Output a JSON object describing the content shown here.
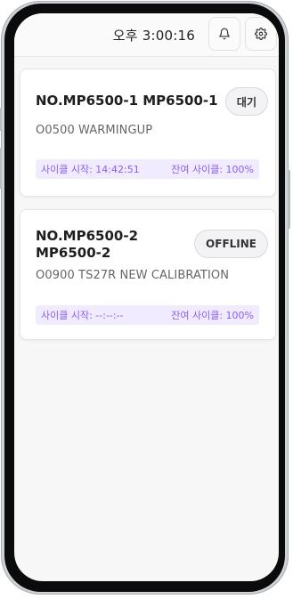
{
  "header": {
    "clock": "오후 3:00:16",
    "icons": [
      "bell-icon",
      "gear-icon"
    ]
  },
  "machines": [
    {
      "title": "NO.MP6500-1 MP6500-1",
      "program": "O0500 WARMINGUP",
      "status": "대기",
      "cycle_start_label": "사이클 시작: 14:42:51",
      "remaining_label": "잔여 사이클: 100%"
    },
    {
      "title": "NO.MP6500-2\nMP6500-2",
      "program": "O0900 TS27R NEW CALIBRATION",
      "status": "OFFLINE",
      "cycle_start_label": "사이클 시작: --:--:--",
      "remaining_label": "잔여 사이클: 100%"
    }
  ],
  "colors": {
    "accent": "#8a5cf6",
    "meta_bg": "#f0ecfd"
  }
}
